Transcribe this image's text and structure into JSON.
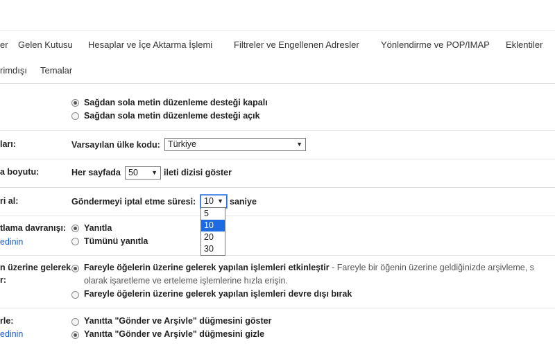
{
  "tabs_row1": [
    "er",
    "Gelen Kutusu",
    "Hesaplar ve İçe Aktarma İşlemi",
    "Filtreler ve Engellenen Adresler",
    "Yönlendirme ve POP/IMAP",
    "Eklentiler"
  ],
  "tabs_row2": [
    "rimdışı",
    "Temalar"
  ],
  "rtl": {
    "opt_off": "Sağdan sola metin düzenleme desteği kapalı",
    "opt_on": "Sağdan sola metin düzenleme desteği açık"
  },
  "country": {
    "label": "ları:",
    "prefix": "Varsayılan ülke kodu:",
    "value": "Türkiye"
  },
  "page_size": {
    "label": "a boyutu:",
    "prefix": "Her sayfada",
    "value": "50",
    "suffix": "ileti dizisi göster"
  },
  "undo_send": {
    "label": "ri al:",
    "prefix": "Göndermeyi iptal etme süresi:",
    "value": "10",
    "suffix": "saniye",
    "options": [
      "5",
      "10",
      "20",
      "30"
    ]
  },
  "reply": {
    "label": "tlama davranışı:",
    "link": "edinin",
    "opt1": "Yanıtla",
    "opt2": "Tümünü yanıtla"
  },
  "hover": {
    "label1": "n üzerine gelerek",
    "label2": "r:",
    "opt_on": "Fareyle öğelerin üzerine gelerek yapılan işlemleri etkinleştir",
    "opt_on_desc": " - Fareyle bir öğenin üzerine geldiğinizde arşivleme, s",
    "opt_on_desc2": "olarak işaretleme ve erteleme işlemlerine hızla erişin.",
    "opt_off": "Fareyle öğelerin üzerine gelerek yapılan işlemleri devre dışı bırak"
  },
  "send_archive": {
    "label": "rle:",
    "link": "edinin",
    "opt_show": "Yanıtta \"Gönder ve Arşivle\" düğmesini göster",
    "opt_hide": "Yanıtta \"Gönder ve Arşivle\" düğmesini gizle"
  }
}
